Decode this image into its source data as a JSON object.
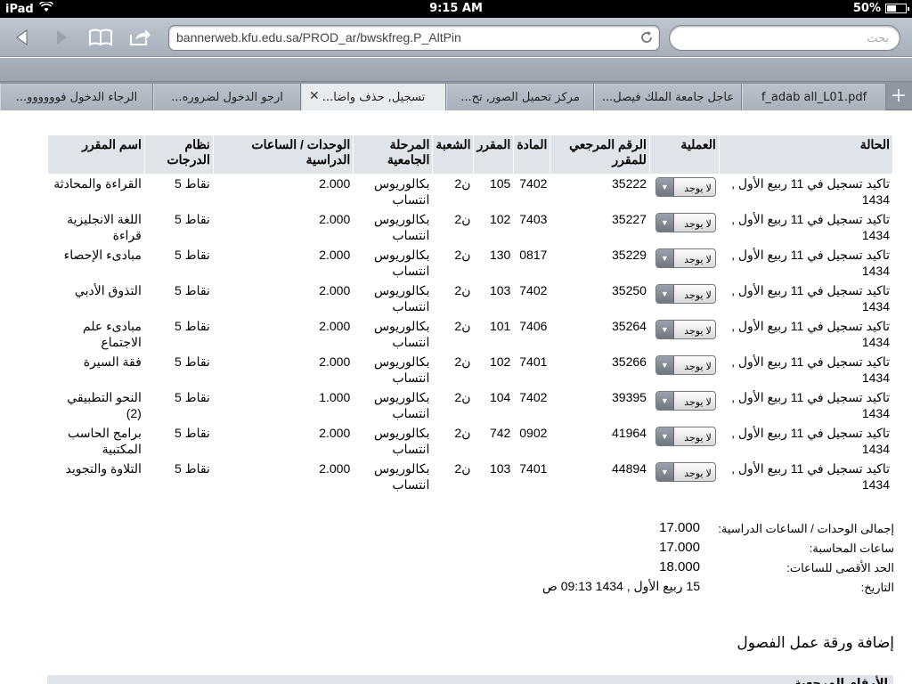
{
  "status_bar": {
    "device": "iPad",
    "time": "9:15 AM",
    "battery": "50%",
    "battery_level": 0.5
  },
  "toolbar": {
    "url": "bannerweb.kfu.edu.sa/PROD_ar/bwskfreg.P_AltPin",
    "search_placeholder": "بحث"
  },
  "tabs": [
    {
      "label": "f_adab all_L01.pdf",
      "active": false
    },
    {
      "label": "عاجل جامعة الملك فيصل...",
      "active": false
    },
    {
      "label": "مركز تحميل الصور, تح...",
      "active": false
    },
    {
      "label": "تسجيل, حذف واضا...",
      "active": true
    },
    {
      "label": "ارجو الدخول لضروره...",
      "active": false
    },
    {
      "label": "الرجاء الدخول فوووووو...",
      "active": false
    }
  ],
  "page": {
    "cut_heading": "...",
    "table": {
      "headers": {
        "status": "الحالة",
        "action": "العملية",
        "crn": "الرقم المرجعي للمقرر",
        "subject": "المادة",
        "course": "المقرر",
        "section": "الشعبة",
        "level": "المرحلة الجامعية",
        "credits": "الوحدات / الساعات الدراسية",
        "grade_mode": "نظام الدرجات",
        "title": "اسم المقرر"
      },
      "rows": [
        {
          "status": "تاكيد تسجيل في 11 ربيع الأول , 1434",
          "action": "لا يوجد",
          "crn": "35222",
          "subject": "7402",
          "course": "105",
          "section": "ن2",
          "level": "بكالوريوس انتساب",
          "credits": "2.000",
          "grade_mode": "نقاط 5",
          "title": "القراءة والمحادثة"
        },
        {
          "status": "تاكيد تسجيل في 11 ربيع الأول , 1434",
          "action": "لا يوجد",
          "crn": "35227",
          "subject": "7403",
          "course": "102",
          "section": "ن2",
          "level": "بكالوريوس انتساب",
          "credits": "2.000",
          "grade_mode": "نقاط 5",
          "title": "اللغة الانجليزية قراءة"
        },
        {
          "status": "تاكيد تسجيل في 11 ربيع الأول , 1434",
          "action": "لا يوجد",
          "crn": "35229",
          "subject": "0817",
          "course": "130",
          "section": "ن2",
          "level": "بكالوريوس انتساب",
          "credits": "2.000",
          "grade_mode": "نقاط 5",
          "title": "مبادىء الإحصاء"
        },
        {
          "status": "تاكيد تسجيل في 11 ربيع الأول , 1434",
          "action": "لا يوجد",
          "crn": "35250",
          "subject": "7402",
          "course": "103",
          "section": "ن2",
          "level": "بكالوريوس انتساب",
          "credits": "2.000",
          "grade_mode": "نقاط 5",
          "title": "التذوق الأدبي"
        },
        {
          "status": "تاكيد تسجيل في 11 ربيع الأول , 1434",
          "action": "لا يوجد",
          "crn": "35264",
          "subject": "7406",
          "course": "101",
          "section": "ن2",
          "level": "بكالوريوس انتساب",
          "credits": "2.000",
          "grade_mode": "نقاط 5",
          "title": "مبادىء علم الاجتماع"
        },
        {
          "status": "تاكيد تسجيل في 11 ربيع الأول , 1434",
          "action": "لا يوجد",
          "crn": "35266",
          "subject": "7401",
          "course": "102",
          "section": "ن2",
          "level": "بكالوريوس انتساب",
          "credits": "2.000",
          "grade_mode": "نقاط 5",
          "title": "فقة السيرة"
        },
        {
          "status": "تاكيد تسجيل في 11 ربيع الأول , 1434",
          "action": "لا يوجد",
          "crn": "39395",
          "subject": "7402",
          "course": "104",
          "section": "ن2",
          "level": "بكالوريوس انتساب",
          "credits": "1.000",
          "grade_mode": "نقاط 5",
          "title": "النحو التطبيقي (2)"
        },
        {
          "status": "تاكيد تسجيل في 11 ربيع الأول , 1434",
          "action": "لا يوجد",
          "crn": "41964",
          "subject": "0902",
          "course": "742",
          "section": "ن2",
          "level": "بكالوريوس انتساب",
          "credits": "2.000",
          "grade_mode": "نقاط 5",
          "title": "برامج الحاسب المكتبية"
        },
        {
          "status": "تاكيد تسجيل في 11 ربيع الأول , 1434",
          "action": "لا يوجد",
          "crn": "44894",
          "subject": "7401",
          "course": "103",
          "section": "ن2",
          "level": "بكالوريوس انتساب",
          "credits": "2.000",
          "grade_mode": "نقاط 5",
          "title": "التلاوة والتجويد"
        }
      ]
    },
    "summary": {
      "total_credits_label": "إجمالى الوحدات / الساعات الدراسية:",
      "total_credits": "17.000",
      "billing_hours_label": "ساعات المحاسبة:",
      "billing_hours": "17.000",
      "max_hours_label": "الحد الأقصى للساعات:",
      "max_hours": "18.000",
      "date_label": "التاريخ:",
      "date": "15 ربيع الأول , 1434 09:13 ص"
    },
    "add_worksheet_title": "إضافة ورقة عمل الفصول",
    "bottom_header": "الأرقام المرجعية"
  }
}
